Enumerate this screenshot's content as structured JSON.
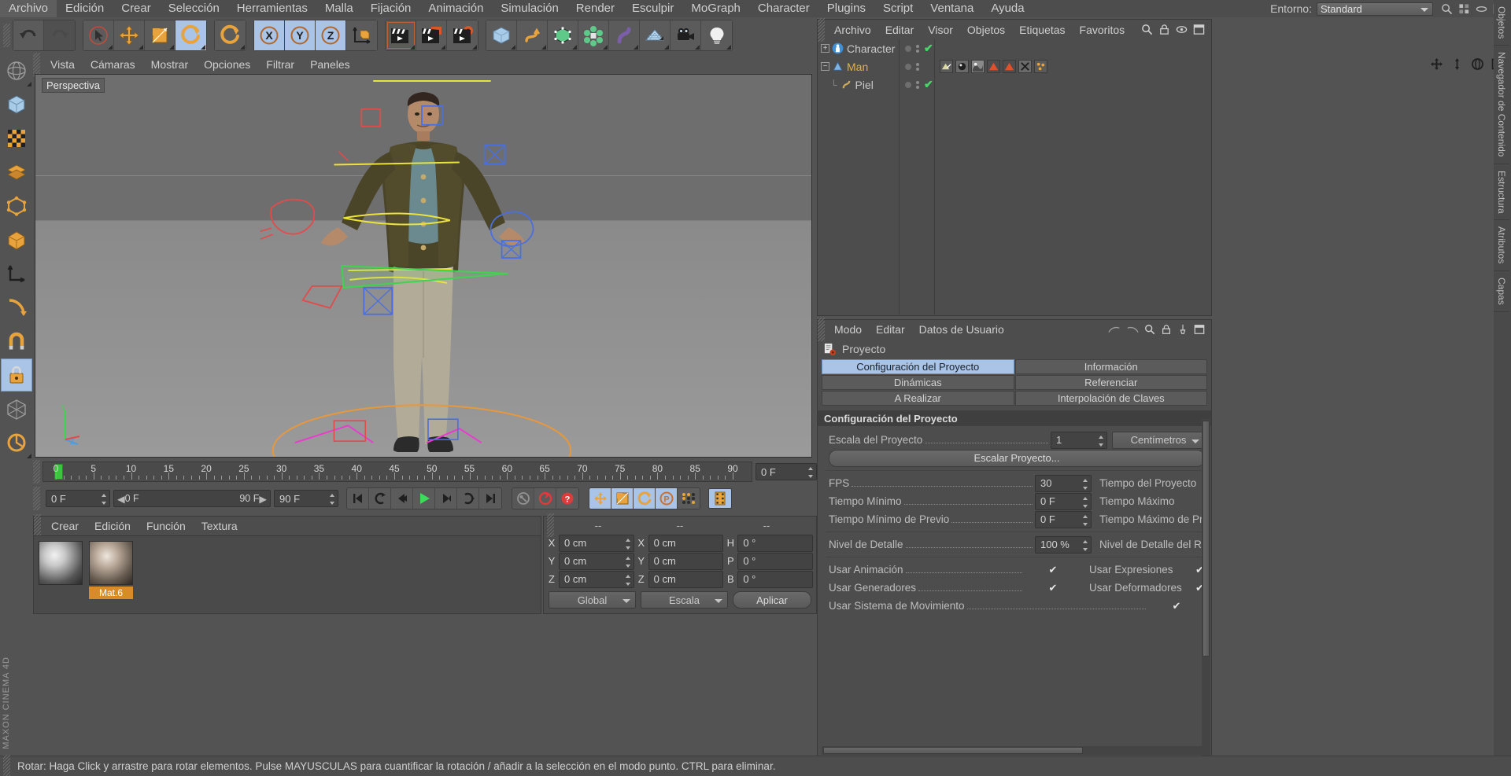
{
  "menubar": {
    "items": [
      "Archivo",
      "Edición",
      "Crear",
      "Selección",
      "Herramientas",
      "Malla",
      "Fijación",
      "Animación",
      "Simulación",
      "Render",
      "Esculpir",
      "MoGraph",
      "Character",
      "Plugins",
      "Script",
      "Ventana",
      "Ayuda"
    ],
    "layout_label": "Entorno:",
    "layout_value": "Standard"
  },
  "toolbar": {
    "groups": [
      {
        "buttons": [
          {
            "name": "undo-button",
            "icon": "undo-icon",
            "state": "normal"
          },
          {
            "name": "redo-button",
            "icon": "redo-icon",
            "state": "disabled"
          }
        ]
      },
      {
        "buttons": [
          {
            "name": "live-selection-button",
            "icon": "cursor-circle-icon",
            "state": "normal"
          },
          {
            "name": "move-tool-button",
            "icon": "move-arrows-icon",
            "state": "normal"
          },
          {
            "name": "scale-tool-button",
            "icon": "scale-box-icon",
            "state": "normal"
          },
          {
            "name": "rotate-tool-button",
            "icon": "rotate-icon",
            "state": "active"
          }
        ]
      },
      {
        "buttons": [
          {
            "name": "rotate-secondary-button",
            "icon": "rotate-icon",
            "state": "normal"
          }
        ]
      },
      {
        "buttons": [
          {
            "name": "lock-x-axis-button",
            "icon": "axis-x-icon",
            "state": "active"
          },
          {
            "name": "lock-y-axis-button",
            "icon": "axis-y-icon",
            "state": "active"
          },
          {
            "name": "lock-z-axis-button",
            "icon": "axis-z-icon",
            "state": "active"
          },
          {
            "name": "world-coordinates-button",
            "icon": "world-axis-icon",
            "state": "normal"
          }
        ]
      },
      {
        "buttons": [
          {
            "name": "render-view-button",
            "icon": "clapboard-icon",
            "state": "normal"
          },
          {
            "name": "render-region-button",
            "icon": "clapboard-region-icon",
            "state": "normal"
          },
          {
            "name": "render-settings-button",
            "icon": "clapboard-gear-icon",
            "state": "normal"
          }
        ]
      },
      {
        "buttons": [
          {
            "name": "add-cube-button",
            "icon": "cube-icon",
            "state": "normal"
          },
          {
            "name": "add-spline-button",
            "icon": "spline-icon",
            "state": "normal"
          },
          {
            "name": "nurbs-button",
            "icon": "green-cube-icon",
            "state": "normal"
          },
          {
            "name": "array-button",
            "icon": "array-icon",
            "state": "normal"
          },
          {
            "name": "deformer-button",
            "icon": "bend-icon",
            "state": "normal"
          },
          {
            "name": "floor-button",
            "icon": "floor-grid-icon",
            "state": "normal"
          },
          {
            "name": "camera-button",
            "icon": "camera-icon",
            "state": "normal"
          },
          {
            "name": "light-button",
            "icon": "light-bulb-icon",
            "state": "normal"
          }
        ]
      }
    ]
  },
  "left_palette": {
    "items": [
      {
        "name": "tool-axis-modify",
        "icon": "axis-modify-icon",
        "state": "normal"
      },
      {
        "name": "tool-object-mode",
        "icon": "object-mode-icon",
        "state": "normal"
      },
      {
        "name": "tool-texture-mode",
        "icon": "texture-mode-icon",
        "state": "normal"
      },
      {
        "name": "tool-points-mode",
        "icon": "points-mode-icon",
        "state": "normal"
      },
      {
        "name": "tool-edges-mode",
        "icon": "edges-mode-icon",
        "state": "normal"
      },
      {
        "name": "tool-polygons-mode",
        "icon": "polygons-mode-icon",
        "state": "normal"
      },
      {
        "name": "tool-model-mode",
        "icon": "model-mode-icon",
        "state": "normal"
      },
      {
        "name": "tool-workplane",
        "icon": "workplane-icon",
        "state": "normal"
      },
      {
        "name": "tool-magnet",
        "icon": "magnet-icon",
        "state": "normal"
      },
      {
        "name": "tool-lock-axis",
        "icon": "lock-icon",
        "state": "active"
      },
      {
        "name": "tool-snap",
        "icon": "snap-grid-icon",
        "state": "normal"
      },
      {
        "name": "tool-quantize",
        "icon": "quantize-icon",
        "state": "normal"
      }
    ],
    "brand": "MAXON CINEMA 4D"
  },
  "viewport": {
    "menu": [
      "Vista",
      "Cámaras",
      "Mostrar",
      "Opciones",
      "Filtrar",
      "Paneles"
    ],
    "label": "Perspectiva",
    "icons": [
      "pan-icon",
      "dolly-icon",
      "orbit-icon",
      "maximize-icon"
    ],
    "axis": {
      "y": "Y",
      "z": "Z",
      "x": "X"
    }
  },
  "timeline": {
    "ticks": [
      "0",
      "5",
      "10",
      "15",
      "20",
      "25",
      "30",
      "35",
      "40",
      "45",
      "50",
      "55",
      "60",
      "65",
      "70",
      "75",
      "80",
      "85",
      "90"
    ],
    "current_frame_field": "0 F",
    "start_field": "0 F",
    "range_start": "0 F",
    "range_end": "90 F",
    "end_field": "90 F",
    "transport": [
      {
        "name": "go-to-start-button",
        "icon": "skip-start-icon"
      },
      {
        "name": "previous-key-button",
        "icon": "prev-key-icon"
      },
      {
        "name": "previous-frame-button",
        "icon": "step-back-icon"
      },
      {
        "name": "play-button",
        "icon": "play-icon"
      },
      {
        "name": "next-frame-button",
        "icon": "step-forward-icon"
      },
      {
        "name": "next-key-button",
        "icon": "next-key-icon"
      },
      {
        "name": "go-to-end-button",
        "icon": "skip-end-icon"
      }
    ],
    "record_tools": [
      {
        "name": "record-active-objects-button",
        "icon": "key-record-icon"
      },
      {
        "name": "autokeying-button",
        "icon": "autokey-icon"
      },
      {
        "name": "keyframe-selection-button",
        "icon": "keyframe-help-icon"
      }
    ],
    "key_toggles": [
      {
        "name": "record-position-button",
        "icon": "position-key-icon",
        "state": "active"
      },
      {
        "name": "record-scale-button",
        "icon": "scale-key-icon",
        "state": "active"
      },
      {
        "name": "record-rotation-button",
        "icon": "rotation-key-icon",
        "state": "active"
      },
      {
        "name": "record-pla-button",
        "icon": "pla-key-icon",
        "state": "active"
      },
      {
        "name": "record-points-button",
        "icon": "points-key-icon",
        "state": "normal"
      },
      {
        "name": "timeline-toggle-button",
        "icon": "film-strip-icon",
        "state": "active"
      }
    ]
  },
  "materials": {
    "menu": [
      "Crear",
      "Edición",
      "Función",
      "Textura"
    ],
    "items": [
      {
        "name": "material-swatch-empty",
        "label": "",
        "selected": false
      },
      {
        "name": "material-swatch-mat6",
        "label": "Mat.6",
        "selected": true
      }
    ]
  },
  "coordinates": {
    "headers": [
      "--",
      "--",
      "--"
    ],
    "rows": [
      {
        "axis": "X",
        "position": "0 cm",
        "size": "0 cm",
        "rot_label": "H",
        "rotation": "0 °"
      },
      {
        "axis": "Y",
        "position": "0 cm",
        "size": "0 cm",
        "rot_label": "P",
        "rotation": "0 °"
      },
      {
        "axis": "Z",
        "position": "0 cm",
        "size": "0 cm",
        "rot_label": "B",
        "rotation": "0 °"
      }
    ],
    "system": "Global",
    "mode": "Escala",
    "apply": "Aplicar"
  },
  "object_manager": {
    "menu": [
      "Archivo",
      "Editar",
      "Visor",
      "Objetos",
      "Etiquetas",
      "Favoritos"
    ],
    "icons": [
      "search-icon",
      "lock-icon",
      "eye-icon",
      "panel-icon"
    ],
    "tree": [
      {
        "name": "object-row-character",
        "label": "Character",
        "expander": "+",
        "depth": 0,
        "selected": false,
        "icon": "character-icon",
        "tags": []
      },
      {
        "name": "object-row-man",
        "label": "Man",
        "expander": "-",
        "depth": 0,
        "selected": true,
        "icon": "null-object-icon",
        "tags": [
          "weight-tag",
          "icon-tag-a",
          "icon-tag-b",
          "tri-tag-1",
          "tri-tag-2",
          "xpresso-tag",
          "dots-tag"
        ]
      },
      {
        "name": "object-row-piel",
        "label": "Piel",
        "expander": "",
        "depth": 1,
        "selected": false,
        "icon": "deformer-icon",
        "tags": []
      }
    ]
  },
  "attributes": {
    "menu": [
      "Modo",
      "Editar",
      "Datos de Usuario"
    ],
    "title": "Proyecto",
    "tabs": [
      {
        "label": "Configuración del Proyecto",
        "active": true
      },
      {
        "label": "Información",
        "active": false
      },
      {
        "label": "Dinámicas",
        "active": false
      },
      {
        "label": "Referenciar",
        "active": false
      },
      {
        "label": "A Realizar",
        "active": false
      },
      {
        "label": "Interpolación de Claves",
        "active": false
      }
    ],
    "section_title": "Configuración del Proyecto",
    "rows": [
      {
        "name": "project-scale-row",
        "label": "Escala del Proyecto",
        "value": "1",
        "type": "num",
        "unit": "Centímetros"
      },
      {
        "name": "scale-project-button-row",
        "label": "Escalar Proyecto...",
        "type": "button"
      },
      {
        "name": "fps-row",
        "label": "FPS",
        "value": "30",
        "type": "num",
        "right_label": "Tiempo del Proyecto",
        "right_value": ""
      },
      {
        "name": "min-time-row",
        "label": "Tiempo Mínimo",
        "value": "0 F",
        "type": "num",
        "right_label": "Tiempo Máximo",
        "right_value": ""
      },
      {
        "name": "min-preview-time-row",
        "label": "Tiempo Mínimo de Previo",
        "value": "0 F",
        "type": "num",
        "right_label": "Tiempo Máximo de Previo",
        "right_value": ""
      },
      {
        "name": "level-of-detail-row",
        "label": "Nivel de Detalle",
        "value": "100 %",
        "type": "num",
        "right_label": "Nivel de Detalle del Render",
        "right_value": ""
      },
      {
        "name": "use-animation-row",
        "label": "Usar Animación",
        "value": "✔",
        "type": "check",
        "right_label": "Usar Expresiones",
        "right_value": "✔"
      },
      {
        "name": "use-generators-row",
        "label": "Usar Generadores",
        "value": "✔",
        "type": "check",
        "right_label": "Usar Deformadores",
        "right_value": "✔"
      },
      {
        "name": "use-motion-system-row",
        "label": "Usar Sistema de Movimiento",
        "value": "✔",
        "type": "check",
        "right_label": "",
        "right_value": ""
      }
    ]
  },
  "right_tabs": [
    "Objetos",
    "Navegador de Contenido",
    "Estructura",
    "Atributos",
    "Capas"
  ],
  "statusbar": {
    "message": "Rotar: Haga Click y arrastre para rotar elementos. Pulse MAYUSCULAS para cuantificar la rotación / añadir a la selección en el modo punto. CTRL para eliminar."
  },
  "colors": {
    "accent_blue": "#a9c4e6",
    "orange": "#e8a33d",
    "green": "#49d86a",
    "selected_text": "#e4b23c",
    "panel_bg": "#4d4d4d",
    "app_bg": "#535353"
  }
}
